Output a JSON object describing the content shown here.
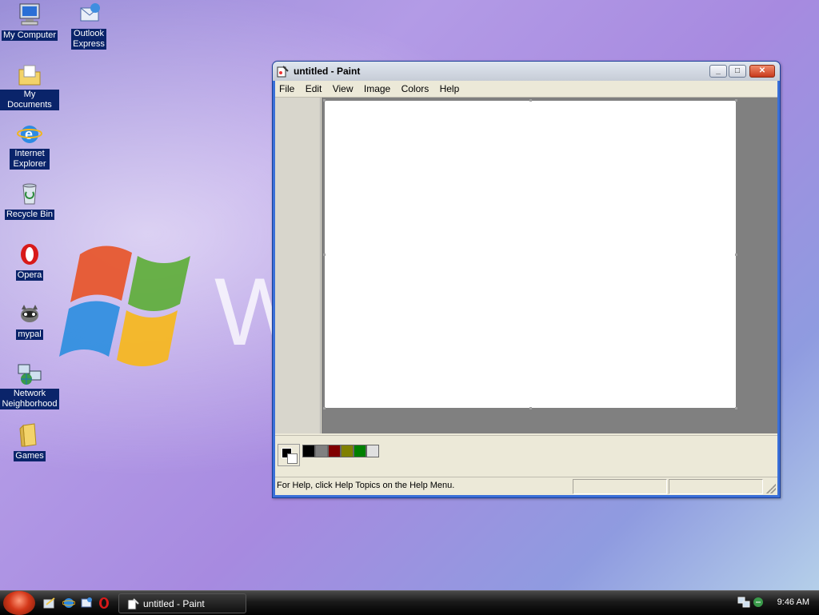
{
  "desktop": {
    "icons": [
      {
        "label": "My Computer"
      },
      {
        "label": "Outlook Express"
      },
      {
        "label": "My Documents"
      },
      {
        "label": "Internet Explorer"
      },
      {
        "label": "Recycle Bin"
      },
      {
        "label": "Opera"
      },
      {
        "label": "mypal"
      },
      {
        "label": "Network Neighborhood"
      },
      {
        "label": "Games"
      }
    ]
  },
  "paint": {
    "title": "untitled - Paint",
    "menu": [
      "File",
      "Edit",
      "View",
      "Image",
      "Colors",
      "Help"
    ],
    "status_text": "For Help, click Help Topics on the Help Menu.",
    "palette_colors": [
      "#000000",
      "#808080",
      "#800000",
      "#808000",
      "#008000",
      "#e0e0e0"
    ],
    "foreground_color": "#000000",
    "background_color": "#ffffff",
    "titlebar_buttons": [
      "minimize",
      "maximize",
      "close"
    ]
  },
  "taskbar": {
    "task_label": "untitled - Paint",
    "clock": "9:46 AM"
  }
}
